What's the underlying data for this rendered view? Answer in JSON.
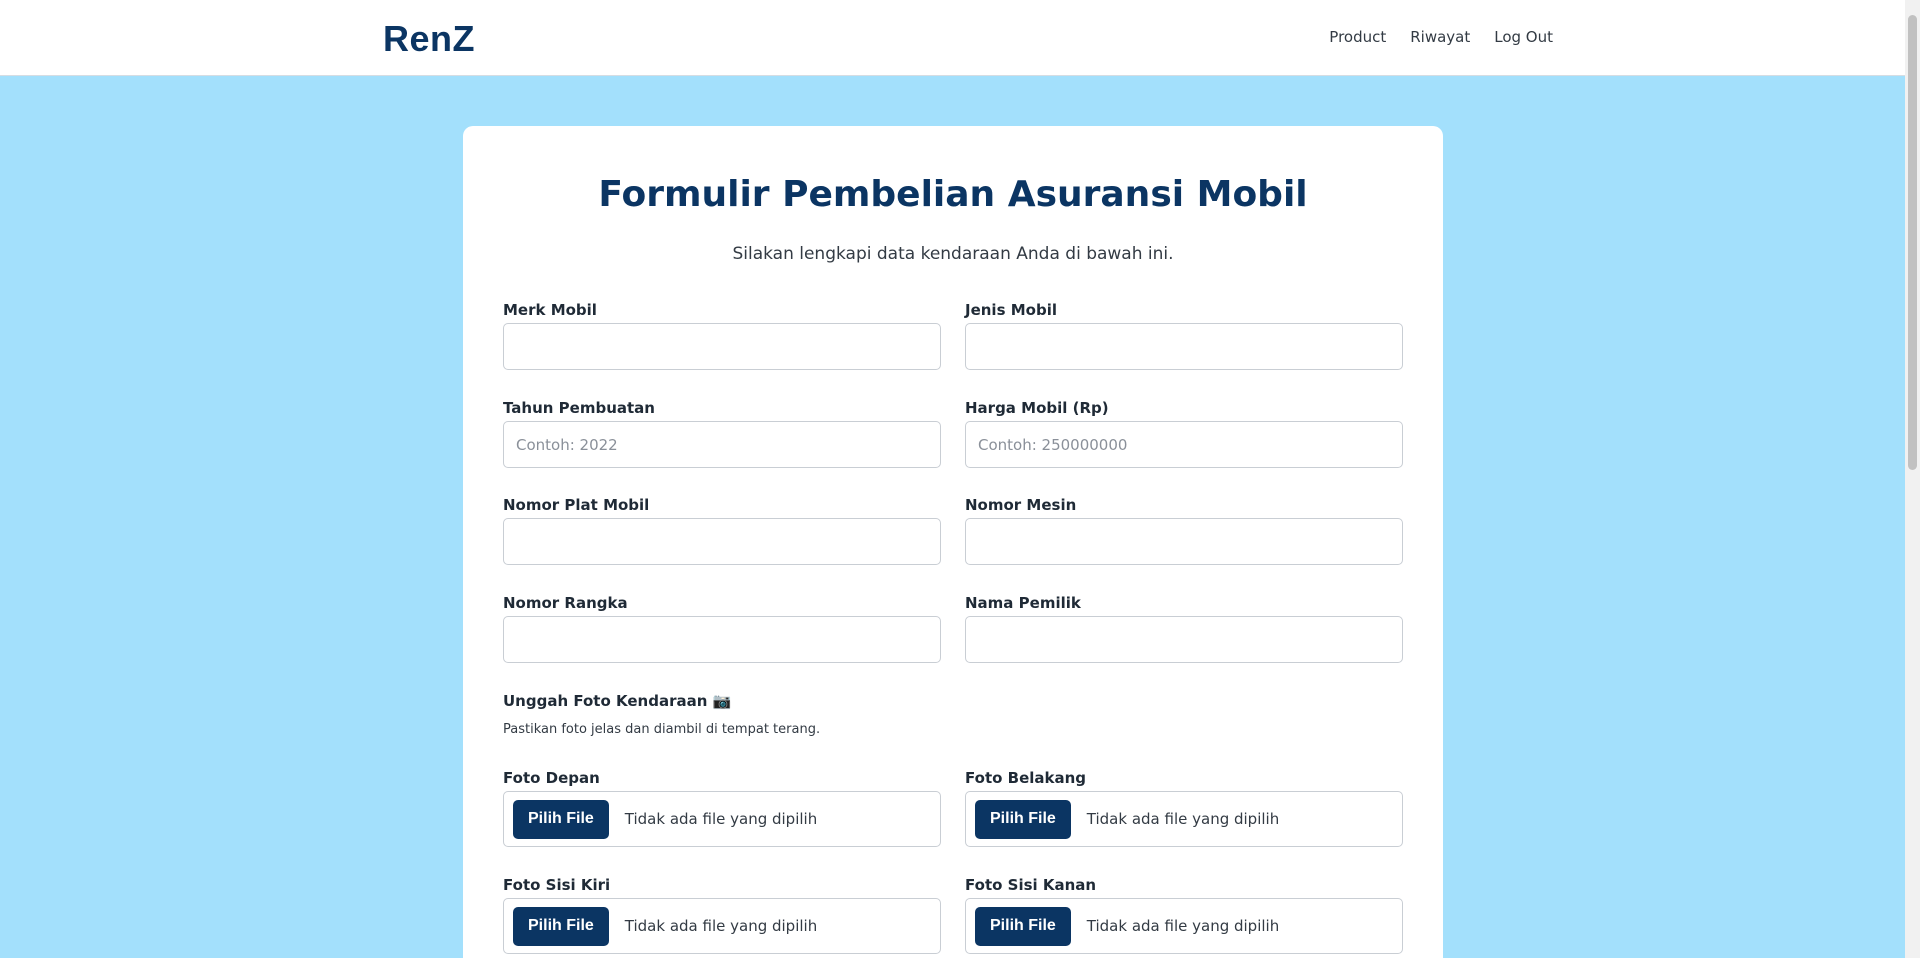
{
  "navbar": {
    "brand": "RenZ",
    "links": [
      {
        "label": "Product"
      },
      {
        "label": "Riwayat"
      },
      {
        "label": "Log Out"
      }
    ]
  },
  "form": {
    "title": "Formulir Pembelian Asuransi Mobil",
    "subtitle": "Silakan lengkapi data kendaraan Anda di bawah ini.",
    "fields": [
      {
        "label": "Merk Mobil",
        "placeholder": "",
        "value": ""
      },
      {
        "label": "Jenis Mobil",
        "placeholder": "",
        "value": ""
      },
      {
        "label": "Tahun Pembuatan",
        "placeholder": "Contoh: 2022",
        "value": ""
      },
      {
        "label": "Harga Mobil (Rp)",
        "placeholder": "Contoh: 250000000",
        "value": ""
      },
      {
        "label": "Nomor Plat Mobil",
        "placeholder": "",
        "value": ""
      },
      {
        "label": "Nomor Mesin",
        "placeholder": "",
        "value": ""
      },
      {
        "label": "Nomor Rangka",
        "placeholder": "",
        "value": ""
      },
      {
        "label": "Nama Pemilik",
        "placeholder": "",
        "value": ""
      }
    ],
    "upload": {
      "title": "Unggah Foto Kendaraan 📷",
      "note": "Pastikan foto jelas dan diambil di tempat terang.",
      "button_label": "Pilih File",
      "status": "Tidak ada file yang dipilih",
      "photos": [
        {
          "label": "Foto Depan"
        },
        {
          "label": "Foto Belakang"
        },
        {
          "label": "Foto Sisi Kiri"
        },
        {
          "label": "Foto Sisi Kanan"
        }
      ]
    }
  },
  "colors": {
    "page_background": "#a3e0fc",
    "brand": "#0b3563",
    "button": "#0b3563"
  }
}
